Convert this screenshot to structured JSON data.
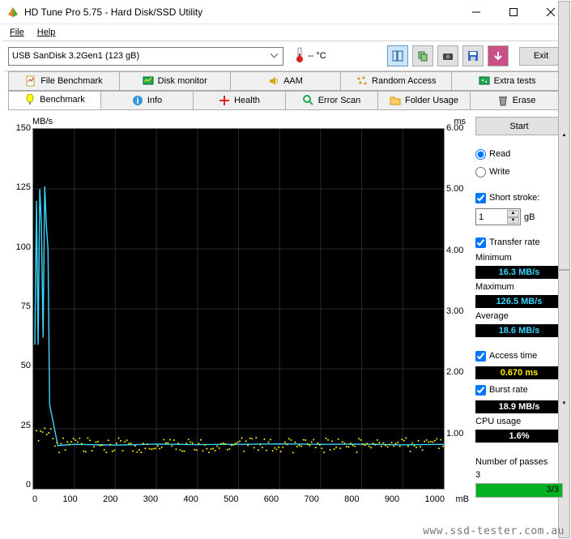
{
  "window": {
    "title": "HD Tune Pro 5.75 - Hard Disk/SSD Utility"
  },
  "menu": {
    "file": "File",
    "help": "Help"
  },
  "toolbar": {
    "drive": "USB SanDisk 3.2Gen1 (123 gB)",
    "temp": "-- °C",
    "exit": "Exit"
  },
  "tabs": {
    "row1": [
      "File Benchmark",
      "Disk monitor",
      "AAM",
      "Random Access",
      "Extra tests"
    ],
    "row2": [
      "Benchmark",
      "Info",
      "Health",
      "Error Scan",
      "Folder Usage",
      "Erase"
    ]
  },
  "chart_data": {
    "type": "line",
    "title": "",
    "xlabel": "",
    "ylabel_left": "MB/s",
    "ylabel_right": "ms",
    "xlim": [
      0,
      1000
    ],
    "xticks": [
      0,
      100,
      200,
      300,
      400,
      500,
      600,
      700,
      800,
      900,
      1000
    ],
    "ylim_left": [
      0,
      150
    ],
    "yticks_left": [
      0,
      25,
      50,
      75,
      100,
      125,
      150
    ],
    "ylim_right": [
      0,
      6.0
    ],
    "yticks_right": [
      "",
      "1.00",
      "2.00",
      "3.00",
      "4.00",
      "5.00",
      "6.00"
    ],
    "xunit": "mB",
    "series": [
      {
        "name": "transfer-rate",
        "color": "#3bd6ff",
        "x": [
          4,
          8,
          12,
          16,
          20,
          24,
          28,
          32,
          36,
          40,
          60,
          100,
          200,
          300,
          400,
          500,
          600,
          700,
          800,
          900,
          1000
        ],
        "y": [
          60,
          120,
          60,
          125,
          110,
          63,
          126,
          110,
          100,
          35,
          18,
          18.5,
          18.2,
          18.6,
          18.4,
          18.5,
          18.7,
          18.5,
          18.6,
          18.3,
          18.5
        ]
      },
      {
        "name": "access-time-scatter",
        "color": "#fff000",
        "type": "scatter",
        "note": "dense scatter band ~0.5-0.9ms across full x-range, estimated",
        "x": [
          10,
          40,
          70,
          100,
          130,
          160,
          190,
          220,
          250,
          280,
          310,
          340,
          370,
          400,
          430,
          460,
          490,
          520,
          550,
          580,
          610,
          640,
          670,
          700,
          730,
          760,
          790,
          820,
          850,
          880,
          910,
          940,
          970,
          1000
        ],
        "y": [
          0.9,
          0.65,
          0.7,
          0.6,
          0.68,
          0.62,
          0.72,
          0.6,
          0.7,
          0.65,
          0.7,
          0.6,
          0.68,
          0.72,
          0.6,
          0.7,
          0.62,
          0.68,
          0.7,
          0.6,
          0.7,
          0.65,
          0.62,
          0.7,
          0.72,
          0.6,
          0.68,
          0.65,
          0.7,
          0.62,
          0.7,
          0.65,
          0.68,
          0.7
        ]
      }
    ]
  },
  "side": {
    "start": "Start",
    "read": "Read",
    "write": "Write",
    "shortstroke": "Short stroke:",
    "shortstroke_val": "1",
    "shortstroke_unit": "gB",
    "transferrate": "Transfer rate",
    "min_l": "Minimum",
    "min_v": "16.3 MB/s",
    "max_l": "Maximum",
    "max_v": "126.5 MB/s",
    "avg_l": "Average",
    "avg_v": "18.6 MB/s",
    "access_l": "Access time",
    "access_v": "0.670 ms",
    "burst_l": "Burst rate",
    "burst_v": "18.9 MB/s",
    "cpu_l": "CPU usage",
    "cpu_v": "1.6%",
    "passes_l": "Number of passes",
    "passes_v": "3",
    "passes_p": "3/3"
  },
  "watermark": "www.ssd-tester.com.au"
}
